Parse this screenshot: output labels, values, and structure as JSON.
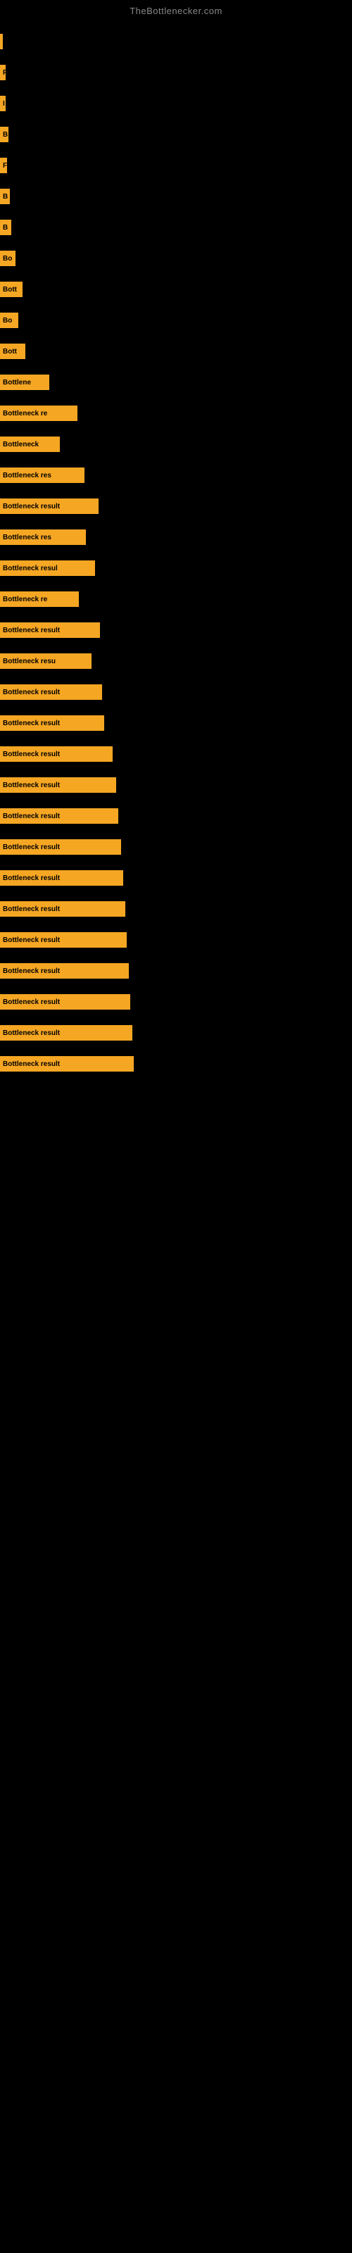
{
  "site": {
    "title": "TheBottlenecker.com"
  },
  "bars": [
    {
      "label": "|",
      "width": 4
    },
    {
      "label": "F",
      "width": 8
    },
    {
      "label": "I",
      "width": 8
    },
    {
      "label": "B",
      "width": 12
    },
    {
      "label": "F",
      "width": 10
    },
    {
      "label": "B",
      "width": 14
    },
    {
      "label": "B",
      "width": 16
    },
    {
      "label": "Bo",
      "width": 22
    },
    {
      "label": "Bott",
      "width": 32
    },
    {
      "label": "Bo",
      "width": 26
    },
    {
      "label": "Bott",
      "width": 36
    },
    {
      "label": "Bottlene",
      "width": 70
    },
    {
      "label": "Bottleneck re",
      "width": 110
    },
    {
      "label": "Bottleneck",
      "width": 85
    },
    {
      "label": "Bottleneck res",
      "width": 120
    },
    {
      "label": "Bottleneck result",
      "width": 140
    },
    {
      "label": "Bottleneck res",
      "width": 122
    },
    {
      "label": "Bottleneck resul",
      "width": 135
    },
    {
      "label": "Bottleneck re",
      "width": 112
    },
    {
      "label": "Bottleneck result",
      "width": 142
    },
    {
      "label": "Bottleneck resu",
      "width": 130
    },
    {
      "label": "Bottleneck result",
      "width": 145
    },
    {
      "label": "Bottleneck result",
      "width": 148
    },
    {
      "label": "Bottleneck result",
      "width": 160
    },
    {
      "label": "Bottleneck result",
      "width": 165
    },
    {
      "label": "Bottleneck result",
      "width": 168
    },
    {
      "label": "Bottleneck result",
      "width": 172
    },
    {
      "label": "Bottleneck result",
      "width": 175
    },
    {
      "label": "Bottleneck result",
      "width": 178
    },
    {
      "label": "Bottleneck result",
      "width": 180
    },
    {
      "label": "Bottleneck result",
      "width": 183
    },
    {
      "label": "Bottleneck result",
      "width": 185
    },
    {
      "label": "Bottleneck result",
      "width": 188
    },
    {
      "label": "Bottleneck result",
      "width": 190
    }
  ]
}
